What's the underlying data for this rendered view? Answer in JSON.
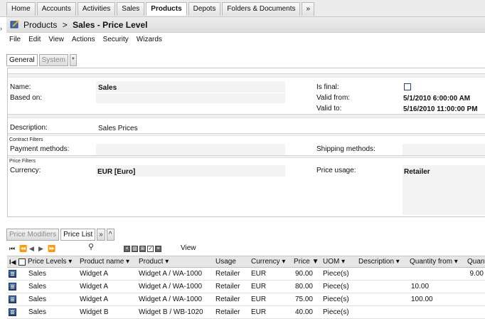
{
  "top_tabs": [
    {
      "label": "Home"
    },
    {
      "label": "Accounts"
    },
    {
      "label": "Activities"
    },
    {
      "label": "Sales"
    },
    {
      "label": "Products"
    },
    {
      "label": "Depots"
    },
    {
      "label": "Folders & Documents"
    },
    {
      "label": "»"
    }
  ],
  "title": {
    "module": "Products",
    "separator": ">",
    "current": "Sales - Price Level"
  },
  "menu": [
    "File",
    "Edit",
    "View",
    "Actions",
    "Security",
    "Wizards"
  ],
  "form_tabs": {
    "general": "General",
    "system": "System",
    "more": "*"
  },
  "form": {
    "name_label": "Name:",
    "name_value": "Sales",
    "based_on_label": "Based on:",
    "is_final_label": "Is final:",
    "valid_from_label": "Valid from:",
    "valid_from_value": "5/1/2010 6:00:00 AM",
    "valid_to_label": "Valid to:",
    "valid_to_value": "5/16/2010 11:00:00 PM",
    "description_label": "Description:",
    "description_value": "Sales Prices",
    "contract_filters_label": "Contract Filters",
    "payment_methods_label": "Payment methods:",
    "shipping_methods_label": "Shipping methods:",
    "price_filters_label": "Price Filters",
    "currency_label": "Currency:",
    "currency_value": "EUR [Euro]",
    "price_usage_label": "Price usage:",
    "price_usage_value": "Retailer"
  },
  "grid_tabs": {
    "modifiers": "Price Modifiers",
    "list": "Price List",
    "more": "»",
    "collapse": "^"
  },
  "grid_toolbar": {
    "view_label": "View"
  },
  "grid": {
    "columns": [
      "Price Levels",
      "Product name",
      "Product",
      "Usage",
      "Currency",
      "Price",
      "UOM",
      "Description",
      "Quantity from",
      "Quant"
    ],
    "rows": [
      [
        "Sales",
        "Widget A",
        "Widget A / WA-1000",
        "Retailer",
        "EUR",
        "90.00",
        "Piece(s)",
        "",
        "",
        "9.00"
      ],
      [
        "Sales",
        "Widget A",
        "Widget A / WA-1000",
        "Retailer",
        "EUR",
        "80.00",
        "Piece(s)",
        "",
        "10.00",
        ""
      ],
      [
        "Sales",
        "Widget A",
        "Widget A / WA-1000",
        "Retailer",
        "EUR",
        "75.00",
        "Piece(s)",
        "",
        "100.00",
        ""
      ],
      [
        "Sales",
        "Widget B",
        "Widget B / WB-1020",
        "Retailer",
        "EUR",
        "40.00",
        "Piece(s)",
        "",
        "",
        ""
      ]
    ]
  }
}
